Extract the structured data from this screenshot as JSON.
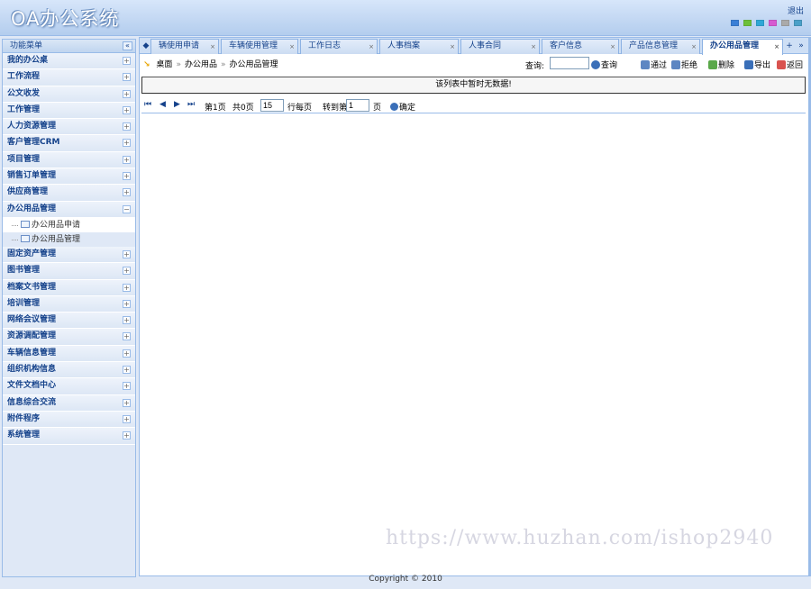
{
  "header": {
    "logo": "OA办公系统",
    "logout": "退出",
    "theme_colors": [
      "#3a7fd6",
      "#6cc03a",
      "#2fa7d6",
      "#d65ad1",
      "#aaaaaa",
      "#4aa0c8"
    ]
  },
  "sidebar": {
    "title": "功能菜单",
    "collapse_icon": "«",
    "items": [
      {
        "label": "我的办公桌",
        "toggle": "+"
      },
      {
        "label": "工作流程",
        "toggle": "+"
      },
      {
        "label": "公文收发",
        "toggle": "+"
      },
      {
        "label": "工作管理",
        "toggle": "+"
      },
      {
        "label": "人力资源管理",
        "toggle": "+"
      },
      {
        "label": "客户管理CRM",
        "toggle": "+"
      },
      {
        "label": "项目管理",
        "toggle": "+"
      },
      {
        "label": "销售订单管理",
        "toggle": "+"
      },
      {
        "label": "供应商管理",
        "toggle": "+"
      },
      {
        "label": "办公用品管理",
        "toggle": "−"
      },
      {
        "label": "固定资产管理",
        "toggle": "+"
      },
      {
        "label": "图书管理",
        "toggle": "+"
      },
      {
        "label": "档案文书管理",
        "toggle": "+"
      },
      {
        "label": "培训管理",
        "toggle": "+"
      },
      {
        "label": "网络会议管理",
        "toggle": "+"
      },
      {
        "label": "资源调配管理",
        "toggle": "+"
      },
      {
        "label": "车辆信息管理",
        "toggle": "+"
      },
      {
        "label": "组织机构信息",
        "toggle": "+"
      },
      {
        "label": "文件文档中心",
        "toggle": "+"
      },
      {
        "label": "信息综合交流",
        "toggle": "+"
      },
      {
        "label": "附件程序",
        "toggle": "+"
      },
      {
        "label": "系统管理",
        "toggle": "+"
      }
    ],
    "submenu": [
      {
        "label": "办公用品申请"
      },
      {
        "label": "办公用品管理"
      }
    ]
  },
  "tabs": {
    "prev_icon": "◆",
    "items": [
      {
        "label": "辆使用申请",
        "close": "×"
      },
      {
        "label": "车辆使用管理",
        "close": "×"
      },
      {
        "label": "工作日志",
        "close": "×"
      },
      {
        "label": "人事档案",
        "close": "×"
      },
      {
        "label": "人事合同",
        "close": "×"
      },
      {
        "label": "客户信息",
        "close": "×"
      },
      {
        "label": "产品信息管理",
        "close": "×"
      },
      {
        "label": "办公用品管理",
        "close": "×"
      }
    ],
    "add_icon": "+",
    "more_icon": "»"
  },
  "breadcrumb": {
    "arrow": "↘",
    "items": [
      "桌面",
      "办公用品",
      "办公用品管理"
    ],
    "sep": "»"
  },
  "toolbar": {
    "search_label": "查询:",
    "search_value": "",
    "buttons": [
      {
        "label": "查询",
        "color": "#3a6fb8"
      },
      {
        "label": "通过",
        "color": "#3a6fb8"
      },
      {
        "label": "拒绝",
        "color": "#3a6fb8"
      },
      {
        "label": "删除",
        "color": "#3a9a3a"
      },
      {
        "label": "导出",
        "color": "#3a6fb8"
      },
      {
        "label": "返回",
        "color": "#d9534f"
      }
    ]
  },
  "empty_message": "该列表中暂时无数据!",
  "pager": {
    "first": "⏮",
    "prev": "◀",
    "next": "▶",
    "last": "⏭",
    "page_text": "第1页",
    "total_text": "共0页",
    "per_page_value": "15",
    "per_page_label": "行每页",
    "goto_label": "转到第",
    "goto_value": "1",
    "page_suffix": "页",
    "confirm": "确定"
  },
  "watermark": "https://www.huzhan.com/ishop2940",
  "footer": "Copyright © 2010"
}
